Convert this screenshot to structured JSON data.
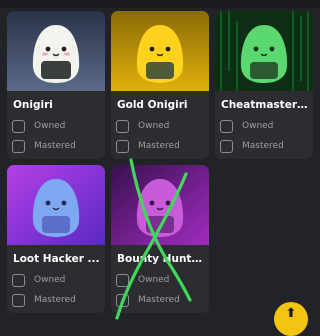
{
  "items": [
    {
      "name": "Onigiri",
      "owned_label": "Owned",
      "mastered_label": "Mastered",
      "thumb_bg": "#4a5a78",
      "mascot_color": "#f0f0ee",
      "band_color": "#3a3f3c"
    },
    {
      "name": "Gold Onigiri",
      "owned_label": "Owned",
      "mastered_label": "Mastered",
      "thumb_bg": "#c79a09",
      "mascot_color": "#ffd21f",
      "band_color": "#4f5a37"
    },
    {
      "name": "Cheatmaster ...",
      "owned_label": "Owned",
      "mastered_label": "Mastered",
      "thumb_bg": "#0f3d1a",
      "mascot_color": "#5bd870",
      "band_color": "#2b5a33"
    },
    {
      "name": "Loot Hacker ...",
      "owned_label": "Owned",
      "mastered_label": "Mastered",
      "thumb_bg": "#8a2fd3",
      "mascot_color": "#7ea8f2",
      "band_color": "#5b6fc9"
    },
    {
      "name": "Bounty Hunte...",
      "owned_label": "Owned",
      "mastered_label": "Mastered",
      "thumb_bg": "#6a1a80",
      "mascot_color": "#c85bd9",
      "band_color": "#7a2f8f"
    }
  ],
  "accent_color": "#f2c511",
  "annotation_color": "#3fd85a",
  "fab_icon": "arrow-up-icon"
}
